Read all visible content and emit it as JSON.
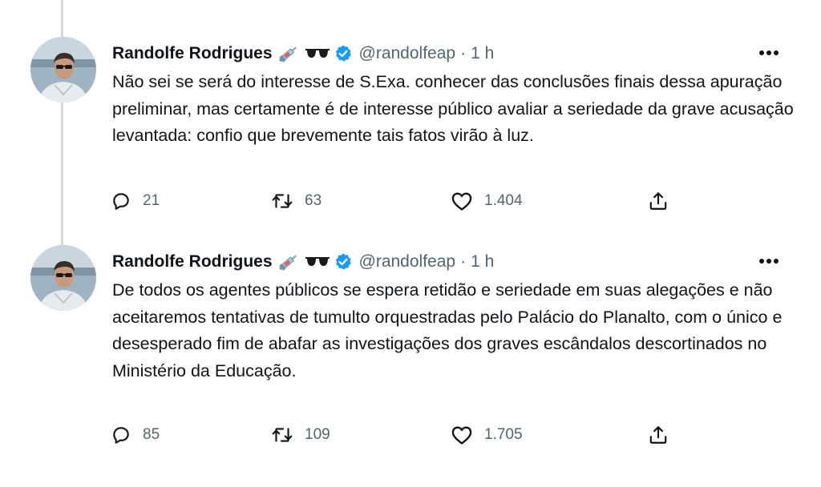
{
  "tweets": [
    {
      "author": "Randolfe Rodrigues",
      "emoji": [
        "syringe",
        "sunglasses"
      ],
      "handle": "@randolfeap",
      "separator": "·",
      "time": "1 h",
      "text": "Não sei se será do interesse de S.Exa. conhecer das conclusões finais dessa apuração preliminar, mas certamente é de interesse público avaliar a seriedade da grave acusação levantada: confio que brevemente tais fatos virão à luz.",
      "replies": "21",
      "retweets": "63",
      "likes": "1.404"
    },
    {
      "author": "Randolfe Rodrigues",
      "emoji": [
        "syringe",
        "sunglasses"
      ],
      "handle": "@randolfeap",
      "separator": "·",
      "time": "1 h",
      "text": "De todos os agentes públicos se espera retidão e seriedade em suas alegações e não aceitaremos tentativas de tumulto orquestradas pelo Palácio do Planalto, com o único e desesperado fim de abafar as investigações dos graves escândalos descortinados no Ministério da Educação.",
      "replies": "85",
      "retweets": "109",
      "likes": "1.705"
    }
  ],
  "colors": {
    "text_primary": "#0f1419",
    "text_secondary": "#536471",
    "verified_blue": "#1d9bf0",
    "thread_line": "#cfd9de"
  },
  "icons": [
    "reply-icon",
    "retweet-icon",
    "like-icon",
    "share-icon",
    "more-icon",
    "verified-icon",
    "syringe-icon",
    "sunglasses-icon"
  ]
}
